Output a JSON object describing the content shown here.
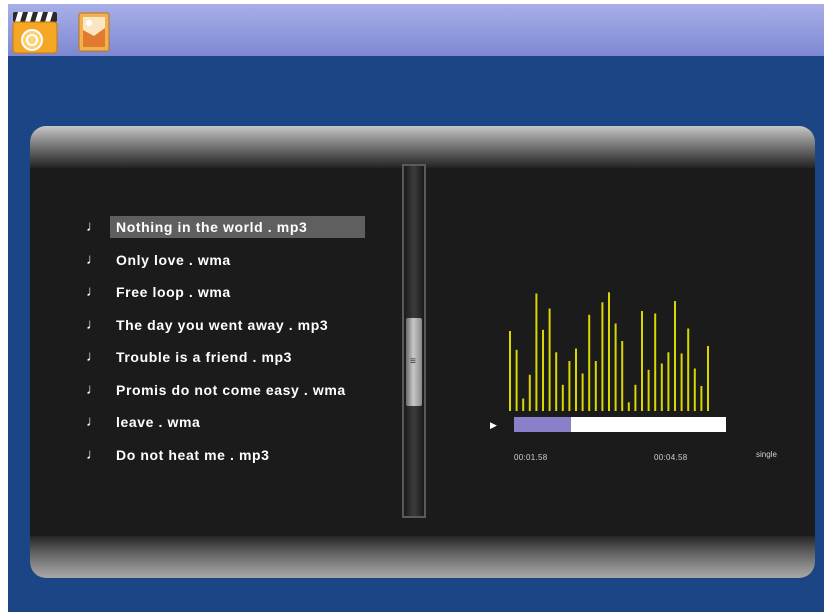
{
  "apps": [
    {
      "name": "video-player",
      "icon": "film-clapper-icon"
    },
    {
      "name": "photo-viewer",
      "icon": "photo-frame-icon"
    }
  ],
  "playlist": {
    "items": [
      {
        "label": "Nothing  in  the  world  . mp3",
        "selected": true
      },
      {
        "label": "Only  love  . wma",
        "selected": false
      },
      {
        "label": "Free  loop  . wma",
        "selected": false
      },
      {
        "label": "The  day  you  went  away  . mp3",
        "selected": false
      },
      {
        "label": "Trouble is a friend  . mp3",
        "selected": false
      },
      {
        "label": "Promis do not come easy  . wma",
        "selected": false
      },
      {
        "label": "leave  . wma",
        "selected": false
      },
      {
        "label": "Do not heat me  . mp3",
        "selected": false
      }
    ],
    "note_icon": "music-note-icon"
  },
  "player": {
    "elapsed": "00:01.58",
    "total": "00:04.58",
    "mode": "single",
    "progress": 0.27,
    "visualizer_levels": [
      0.64,
      0.49,
      0.1,
      0.29,
      0.94,
      0.65,
      0.82,
      0.47,
      0.21,
      0.4,
      0.5,
      0.3,
      0.77,
      0.4,
      0.87,
      0.95,
      0.7,
      0.56,
      0.07,
      0.21,
      0.8,
      0.33,
      0.78,
      0.38,
      0.47,
      0.88,
      0.46,
      0.66,
      0.34,
      0.2,
      0.52
    ],
    "visualizer_color": "#d8d800",
    "progress_color": "#8880c8"
  },
  "colors": {
    "screen_bg": "#1c4585",
    "panel_bg": "#1b1b1b",
    "topbar": "#8f98dc"
  }
}
